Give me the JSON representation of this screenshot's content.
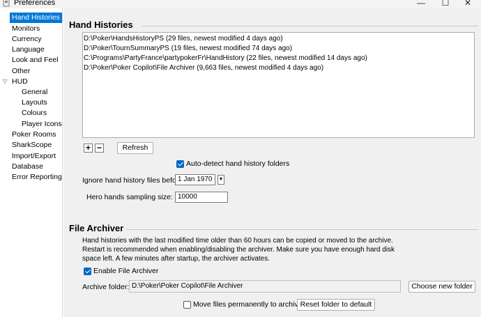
{
  "window": {
    "title": "Preferences",
    "minimize_glyph": "—",
    "maximize_glyph": "☐",
    "close_glyph": "✕"
  },
  "sidebar": {
    "items": [
      {
        "label": "Hand Histories"
      },
      {
        "label": "Monitors"
      },
      {
        "label": "Currency"
      },
      {
        "label": "Language"
      },
      {
        "label": "Look and Feel"
      },
      {
        "label": "Other"
      },
      {
        "label": "HUD"
      },
      {
        "label": "General"
      },
      {
        "label": "Layouts"
      },
      {
        "label": "Colours"
      },
      {
        "label": "Player Icons"
      },
      {
        "label": "Poker Rooms"
      },
      {
        "label": "SharkScope"
      },
      {
        "label": "Import/Export"
      },
      {
        "label": "Database"
      },
      {
        "label": "Error Reporting"
      }
    ],
    "selected": "Hand Histories",
    "hud_toggle_glyph": "▽"
  },
  "hand_histories": {
    "title": "Hand Histories",
    "folders": [
      "D:\\Poker\\HandsHistoryPS (29 files, newest modified 4 days ago)",
      "D:\\Poker\\TournSummaryPS (19 files, newest modified 74 days ago)",
      "C:\\Programs\\PartyFrance\\partypokerFr\\HandHistory (22 files, newest modified 14 days ago)",
      "D:\\Poker\\Poker Copilot\\File Archiver (9,663 files, newest modified 4 days ago)"
    ],
    "add_label": "+",
    "remove_label": "−",
    "refresh_label": "Refresh",
    "auto_detect_label": "Auto-detect hand history folders",
    "auto_detect_checked": true,
    "ignore_before_label": "Ignore hand history files before:",
    "ignore_before_value": "1 Jan 1970",
    "dropdown_glyph": "▼",
    "sampling_label": "Hero hands sampling size:",
    "sampling_value": "10000"
  },
  "file_archiver": {
    "title": "File Archiver",
    "description": [
      "Hand histories with the last modified time older than 60 hours can be copied or moved to the archive.",
      "Restart is recommended when enabling/disabling the archiver. Make sure you have enough hard disk",
      "space left. A few minutes after startup, the archiver activates."
    ],
    "enable_label": "Enable File Archiver",
    "enable_checked": true,
    "folder_label": "Archive folder:",
    "folder_value": "D:\\Poker\\Poker Copilot\\File Archiver",
    "choose_folder_label": "Choose new folder",
    "move_permanently_label": "Move files permanently to archive",
    "move_permanently_checked": false,
    "reset_folder_label": "Reset folder to default"
  },
  "colors": {
    "selection": "#0078d7",
    "checkbox_checked": "#0067c0",
    "panel_background": "#f0f0f0"
  }
}
